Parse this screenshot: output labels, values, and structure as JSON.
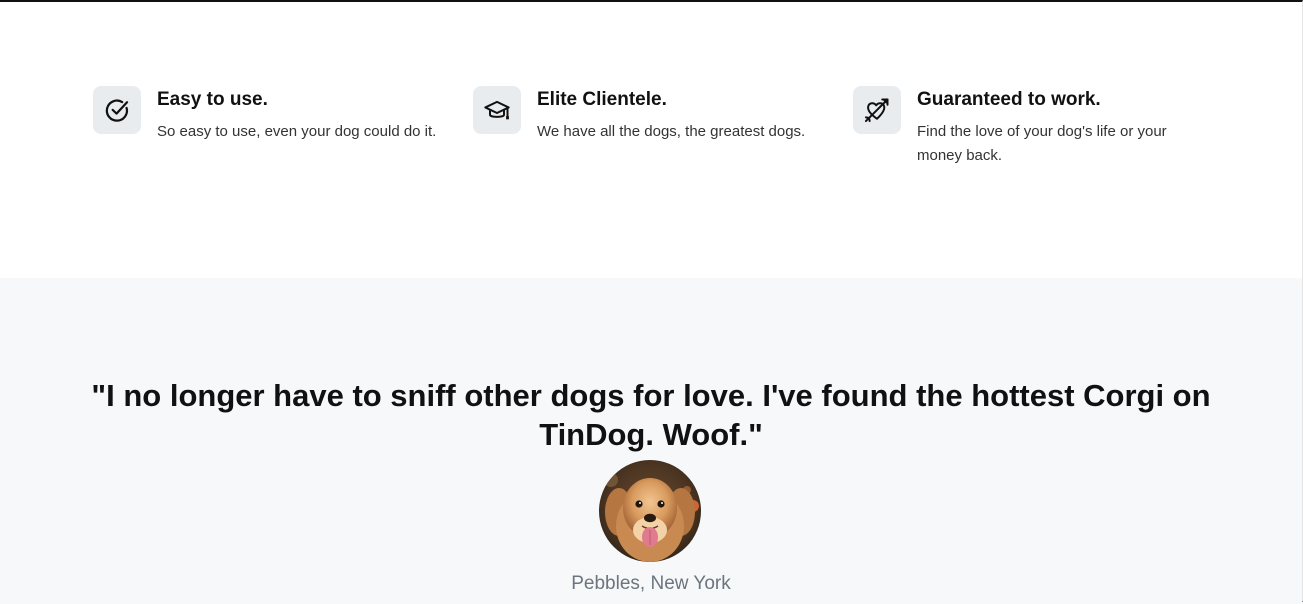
{
  "features": [
    {
      "icon": "check-circle-icon",
      "title": "Easy to use.",
      "description": "So easy to use, even your dog could do it."
    },
    {
      "icon": "graduation-cap-icon",
      "title": "Elite Clientele.",
      "description": "We have all the dogs, the greatest dogs."
    },
    {
      "icon": "heart-arrow-icon",
      "title": "Guaranteed to work.",
      "description": "Find the love of your dog's life or your money back."
    }
  ],
  "testimonial": {
    "quote": "\"I no longer have to sniff other dogs for love. I've found the hottest Corgi on TinDog. Woof.\"",
    "author": "Pebbles, New York",
    "avatar_icon": "dog-avatar-icon"
  },
  "colors": {
    "feature_bg": "#ffffff",
    "testimonial_bg": "#f7f8fa",
    "icon_box_bg": "#e9ecef",
    "heading": "#111111",
    "muted": "#6c757d"
  }
}
